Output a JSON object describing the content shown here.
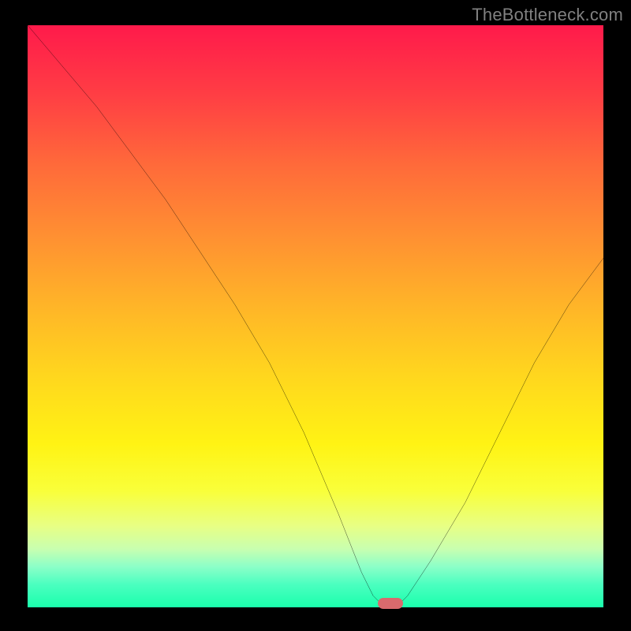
{
  "watermark": "TheBottleneck.com",
  "chart_data": {
    "type": "line",
    "title": "",
    "xlabel": "",
    "ylabel": "",
    "xlim": [
      0,
      100
    ],
    "ylim": [
      0,
      100
    ],
    "grid": false,
    "legend": false,
    "background": "heatmap-gradient-red-to-green",
    "series": [
      {
        "name": "bottleneck-curve",
        "x": [
          0,
          6,
          12,
          18,
          24,
          30,
          36,
          42,
          48,
          54,
          58,
          60,
          62,
          64,
          66,
          70,
          76,
          82,
          88,
          94,
          100
        ],
        "y": [
          100,
          93,
          86,
          78,
          70,
          61,
          52,
          42,
          30,
          16,
          6,
          2,
          0,
          0,
          2,
          8,
          18,
          30,
          42,
          52,
          60
        ]
      }
    ],
    "trough_marker": {
      "x": 63,
      "y": 0,
      "color": "#d96a6d"
    },
    "gradient_stops": [
      {
        "pos": 0,
        "color": "#ff1a4b"
      },
      {
        "pos": 12,
        "color": "#ff3e44"
      },
      {
        "pos": 24,
        "color": "#ff6a3a"
      },
      {
        "pos": 36,
        "color": "#ff8f32"
      },
      {
        "pos": 48,
        "color": "#ffb428"
      },
      {
        "pos": 60,
        "color": "#ffd61e"
      },
      {
        "pos": 72,
        "color": "#fff314"
      },
      {
        "pos": 80,
        "color": "#f9ff3a"
      },
      {
        "pos": 86,
        "color": "#e8ff84"
      },
      {
        "pos": 90,
        "color": "#c8ffb0"
      },
      {
        "pos": 93,
        "color": "#8cffc8"
      },
      {
        "pos": 96,
        "color": "#4cffc0"
      },
      {
        "pos": 100,
        "color": "#1affac"
      }
    ]
  }
}
